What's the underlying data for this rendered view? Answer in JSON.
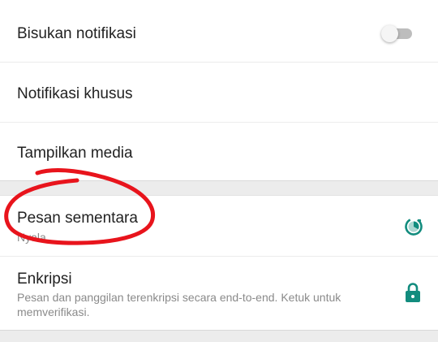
{
  "settings": {
    "mute": {
      "label": "Bisukan notifikasi",
      "enabled": false
    },
    "custom_notifications": {
      "label": "Notifikasi khusus"
    },
    "media_visibility": {
      "label": "Tampilkan media"
    },
    "disappearing_messages": {
      "label": "Pesan sementara",
      "status": "Nyala",
      "icon": "timer-icon"
    },
    "encryption": {
      "label": "Enkripsi",
      "description_line1": "Pesan dan panggilan terenkripsi secara end-to-end. Ketuk untuk",
      "description_line2": "memverifikasi.",
      "icon": "lock-icon"
    }
  },
  "colors": {
    "accent": "#128c7e",
    "annotation": "#e8141c",
    "toggle_off_track": "#bdbdbd"
  }
}
